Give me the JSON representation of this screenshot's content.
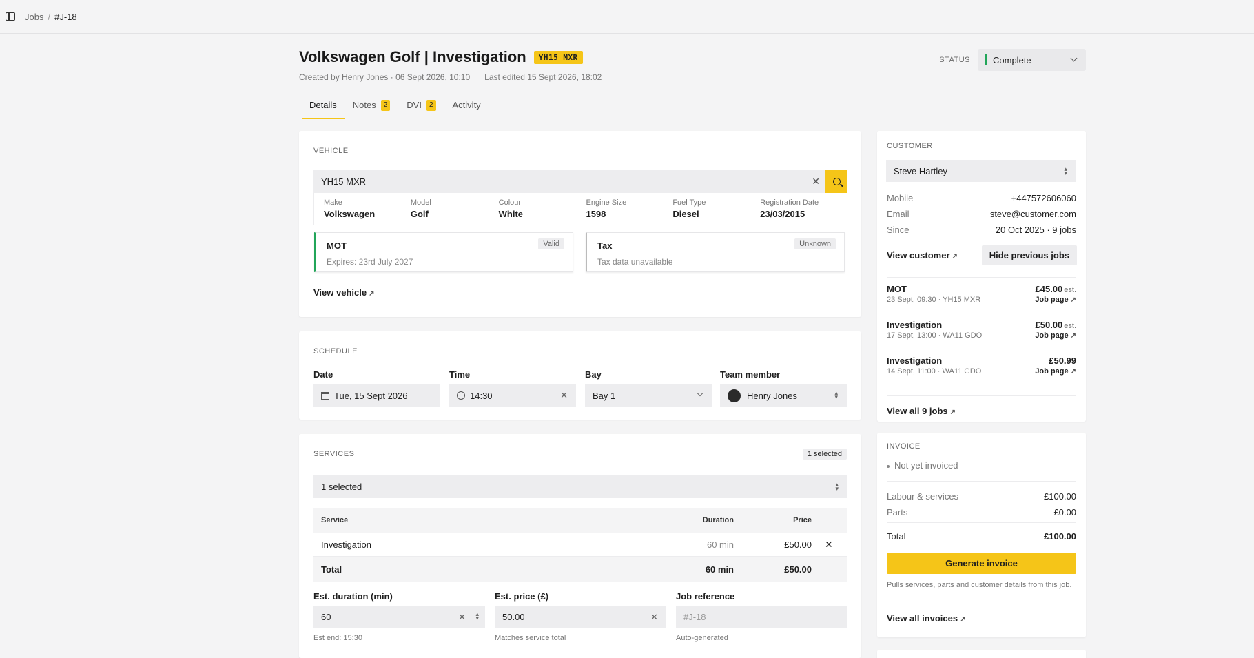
{
  "breadcrumb": {
    "parent": "Jobs",
    "separator": "/",
    "current": "#J-18"
  },
  "header": {
    "title": "Volkswagen Golf | Investigation",
    "plate": "YH15 MXR",
    "created": "Created by Henry Jones · 06 Sept 2026, 10:10",
    "edited": "Last edited 15 Sept 2026, 18:02",
    "status_label": "STATUS",
    "status_value": "Complete",
    "status_color": "#22a559"
  },
  "tabs": [
    {
      "label": "Details",
      "count": ""
    },
    {
      "label": "Notes",
      "count": "2"
    },
    {
      "label": "DVI",
      "count": "2"
    },
    {
      "label": "Activity",
      "count": ""
    }
  ],
  "vehicle": {
    "label": "VEHICLE",
    "search_value": "YH15 MXR",
    "specs": [
      {
        "k": "Make",
        "v": "Volkswagen"
      },
      {
        "k": "Model",
        "v": "Golf"
      },
      {
        "k": "Colour",
        "v": "White"
      },
      {
        "k": "Engine Size",
        "v": "1598"
      },
      {
        "k": "Fuel Type",
        "v": "Diesel"
      },
      {
        "k": "Registration Date",
        "v": "23/03/2015"
      }
    ],
    "mot": {
      "name": "MOT",
      "status": "Valid",
      "sub": "Expires: 23rd July 2027"
    },
    "tax": {
      "name": "Tax",
      "status": "Unknown",
      "sub": "Tax data unavailable"
    },
    "view_link": "View vehicle",
    "arrow": "↗"
  },
  "schedule": {
    "label": "SCHEDULE",
    "date_label": "Date",
    "date_value": "Tue, 15 Sept 2026",
    "time_label": "Time",
    "time_value": "14:30",
    "bay_label": "Bay",
    "bay_value": "Bay 1",
    "team_label": "Team member",
    "team_value": "Henry Jones"
  },
  "services": {
    "label": "SERVICES",
    "badge": "1 selected",
    "select_value": "1 selected",
    "headers": {
      "service": "Service",
      "duration": "Duration",
      "price": "Price"
    },
    "rows": [
      {
        "service": "Investigation",
        "duration": "60 min",
        "price": "£50.00"
      }
    ],
    "total": {
      "label": "Total",
      "duration": "60 min",
      "price": "£50.00"
    },
    "duration_field": {
      "label": "Est. duration (min)",
      "value": "60",
      "hint": "Est end: 15:30"
    },
    "price_field": {
      "label": "Est. price (£)",
      "value": "50.00",
      "hint": "Matches service total"
    },
    "ref_field": {
      "label": "Job reference",
      "placeholder": "#J-18",
      "hint": "Auto-generated"
    }
  },
  "customer": {
    "label": "CUSTOMER",
    "name": "Steve Hartley",
    "mobile_k": "Mobile",
    "mobile_v": "+447572606060",
    "email_k": "Email",
    "email_v": "steve@customer.com",
    "since_k": "Since",
    "since_v": "20 Oct 2025 · 9 jobs",
    "view_link": "View customer",
    "hide_btn": "Hide previous jobs",
    "jobs": [
      {
        "name": "MOT",
        "price": "£45.00",
        "est": "est.",
        "meta": "23 Sept, 09:30 · YH15 MXR",
        "link": "Job page"
      },
      {
        "name": "Investigation",
        "price": "£50.00",
        "est": "est.",
        "meta": "17 Sept, 13:00 · WA11 GDO",
        "link": "Job page"
      },
      {
        "name": "Investigation",
        "price": "£50.99",
        "est": "",
        "meta": "14 Sept, 11:00 · WA11 GDO",
        "link": "Job page"
      }
    ],
    "view_all": "View all 9 jobs"
  },
  "invoice": {
    "label": "INVOICE",
    "state": "Not yet invoiced",
    "labour_k": "Labour & services",
    "labour_v": "£100.00",
    "parts_k": "Parts",
    "parts_v": "£0.00",
    "total_k": "Total",
    "total_v": "£100.00",
    "button": "Generate invoice",
    "note": "Pulls services, parts and customer details from this job.",
    "view_all": "View all invoices"
  },
  "colors": {
    "accent": "#f5c518",
    "success": "#22a559",
    "background": "#f4f4f5"
  }
}
